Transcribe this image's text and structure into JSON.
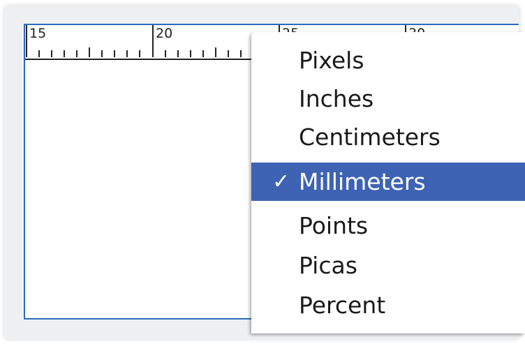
{
  "ruler": {
    "labels": [
      "15",
      "20",
      "25",
      "30"
    ]
  },
  "units_menu": {
    "items": [
      {
        "label": "Pixels",
        "selected": false
      },
      {
        "label": "Inches",
        "selected": false
      },
      {
        "label": "Centimeters",
        "selected": false
      },
      {
        "label": "Millimeters",
        "selected": true
      },
      {
        "label": "Points",
        "selected": false
      },
      {
        "label": "Picas",
        "selected": false
      },
      {
        "label": "Percent",
        "selected": false
      }
    ],
    "check_mark": "✓",
    "highlight_color": "#3e63b5"
  },
  "colors": {
    "canvas_border": "#2d6bbf"
  }
}
